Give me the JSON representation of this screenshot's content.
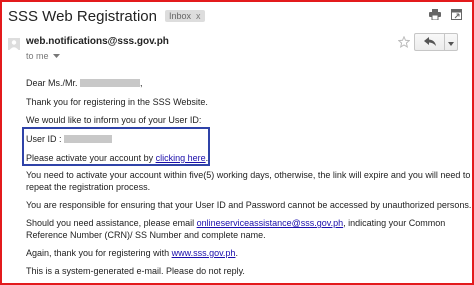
{
  "email": {
    "subject": "SSS Web Registration",
    "label": "Inbox",
    "label_close": "x",
    "sender": "web.notifications@sss.gov.ph",
    "recipient": "to me",
    "body": {
      "greeting": "Dear Ms./Mr.",
      "greeting_end": ",",
      "p1": "Thank you for registering in the SSS Website.",
      "p2": "We would like to inform you of your User ID:",
      "user_id_label": "User ID :",
      "activate_pre": "Please activate your account by ",
      "activate_link": "clicking here",
      "activate_post": ".",
      "p4_line1": "You need to activate your account within five(5) working days, otherwise, the link will expire and you will need to",
      "p4_line2": "repeat the registration process.",
      "p5": "You are responsible for ensuring that your User ID and Password cannot be accessed by unauthorized persons.",
      "p6_pre": "Should you need assistance, please email ",
      "p6_email": "onlineserviceassistance@sss.gov.ph",
      "p6_post": ", indicating your Common",
      "p6_line2": "Reference Number (CRN)/ SS Number and complete name.",
      "p7_pre": "Again, thank you for registering with ",
      "p7_link": "www.sss.gov.ph",
      "p7_post": ".",
      "p8": "This is a system-generated e-mail. Please do not reply."
    }
  },
  "colors": {
    "frame_border": "#e31a1c",
    "highlight_border": "#2f43a8",
    "link": "#1a0dab",
    "redaction": "#c8c8c8"
  },
  "icons": [
    "print-icon",
    "new-window-icon",
    "person-icon",
    "caret-down-icon",
    "star-icon",
    "reply-icon",
    "more-options-icon"
  ]
}
